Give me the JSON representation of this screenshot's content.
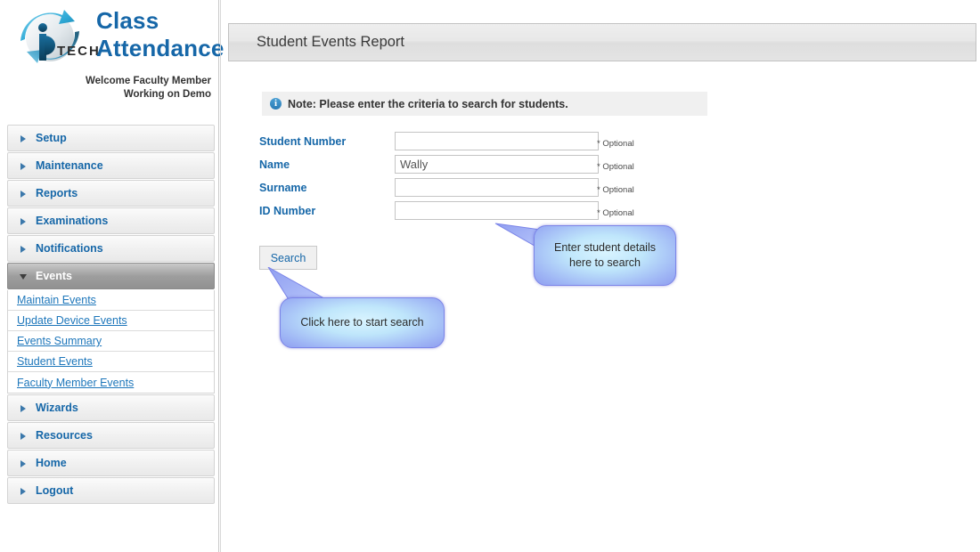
{
  "brand": {
    "title_line1": "Class",
    "title_line2": "Attendance",
    "logo_text": "TECH",
    "welcome_line1": "Welcome Faculty Member",
    "welcome_line2": "Working on Demo"
  },
  "sidebar": {
    "items": [
      {
        "label": "Setup",
        "state": "collapsed"
      },
      {
        "label": "Maintenance",
        "state": "collapsed"
      },
      {
        "label": "Reports",
        "state": "collapsed"
      },
      {
        "label": "Examinations",
        "state": "collapsed"
      },
      {
        "label": "Notifications",
        "state": "collapsed"
      },
      {
        "label": "Events",
        "state": "expanded"
      },
      {
        "label": "Wizards",
        "state": "collapsed"
      },
      {
        "label": "Resources",
        "state": "collapsed"
      },
      {
        "label": "Home",
        "state": "collapsed"
      },
      {
        "label": "Logout",
        "state": "collapsed"
      }
    ],
    "events_submenu": [
      {
        "label": "Maintain Events"
      },
      {
        "label": "Update Device Events"
      },
      {
        "label": "Events Summary"
      },
      {
        "label": "Student Events"
      },
      {
        "label": "Faculty Member Events"
      }
    ]
  },
  "header": {
    "title": "Student Events Report"
  },
  "note": {
    "icon": "info-icon",
    "text": "Note: Please enter the criteria to search for students."
  },
  "form": {
    "fields": [
      {
        "label": "Student Number",
        "value": "",
        "optional": "* Optional"
      },
      {
        "label": "Name",
        "value": "Wally",
        "optional": "* Optional"
      },
      {
        "label": "Surname",
        "value": "",
        "optional": "* Optional"
      },
      {
        "label": "ID Number",
        "value": "",
        "optional": "* Optional"
      }
    ],
    "search_label": "Search"
  },
  "callouts": {
    "search": "Click here to start search",
    "details_line1": "Enter student details",
    "details_line2": "here to search"
  },
  "colors": {
    "link_blue": "#1e77bb",
    "brand_blue": "#1667a8",
    "callout_fill": "#9fb6f5",
    "callout_border": "#7b84e8",
    "active_menu_gray": "#9e9e9e"
  }
}
